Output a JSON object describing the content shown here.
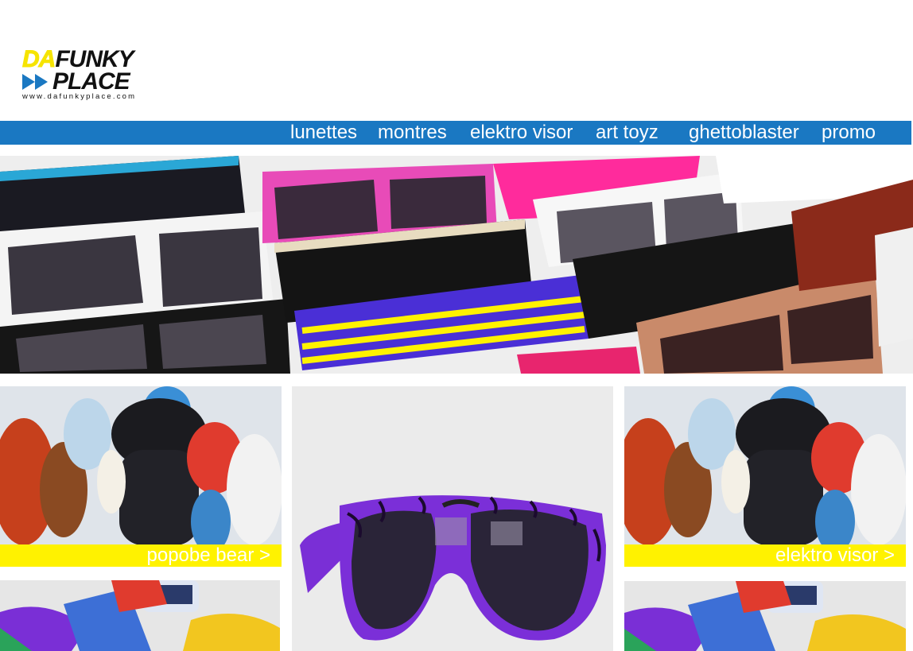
{
  "logo": {
    "da": "DA",
    "funky": "FUNKY",
    "place": "PLACE",
    "url": "www.dafunkyplace.com"
  },
  "nav": {
    "items": [
      {
        "label": "lunettes"
      },
      {
        "label": "montres"
      },
      {
        "label": "elektro visor"
      },
      {
        "label": "art toyz"
      },
      {
        "label": "ghettoblaster"
      },
      {
        "label": "promo"
      }
    ]
  },
  "panels": {
    "toys_left": {
      "caption": "popobe bear >"
    },
    "toys_right": {
      "caption": "elektro visor >"
    }
  },
  "colors": {
    "nav_bg": "#1a78c2",
    "caption_bg": "#fff200",
    "logo_accent": "#f6e400"
  }
}
